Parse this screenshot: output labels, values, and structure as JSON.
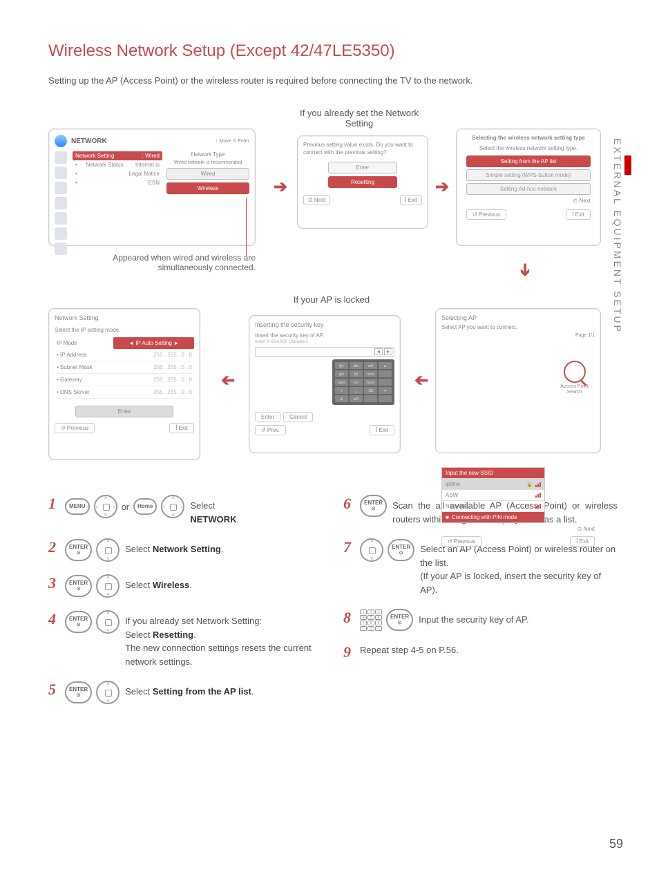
{
  "title": "Wireless Network Setup (Except 42/47LE5350)",
  "intro": "Setting up the AP (Access Point) or the wireless router is required before connecting the TV to the network.",
  "sideTab": "EXTERNAL EQUIPMENT SETUP",
  "pageNum": "59",
  "captions": {
    "a": "Appeared when wired and wireless are simultaneously connected.",
    "b": "If you already set the Network Setting",
    "c": "If your AP is locked"
  },
  "panelA": {
    "title": "NETWORK",
    "hint": "↕ Move   ⊙ Enter",
    "rows": [
      {
        "k": "Network Setting",
        "v": ": Wired",
        "sel": true
      },
      {
        "k": "Network Status",
        "v": ": Internet is"
      },
      {
        "k": "Legal Notice",
        "v": ""
      },
      {
        "k": "ESN",
        "v": ""
      }
    ],
    "rightLabel": "Network Type",
    "rightSub": "Wired network is recommended",
    "btns": [
      {
        "t": "Wired",
        "sel": false
      },
      {
        "t": "Wireless",
        "sel": true
      }
    ]
  },
  "panelB": {
    "msg": "Previous setting value exists. Do you want to connect with the previous setting?",
    "btns": [
      {
        "t": "Enter",
        "sel": false
      },
      {
        "t": "Resetting",
        "sel": true
      }
    ],
    "next": "⊙ Next",
    "exit": "ꟾ Exit"
  },
  "panelC": {
    "hdr": "Selecting the wireless network setting type",
    "sub": "Select the wireless network setting type.",
    "opts": [
      {
        "t": "Setting from the AP list",
        "sel": true
      },
      {
        "t": "Simple setting (WPS-button mode)",
        "sel": false
      },
      {
        "t": "Setting Ad-hoc network",
        "sel": false
      }
    ],
    "next": "⊙ Next",
    "prev": "↺ Previous",
    "exit": "ꟾ Exit"
  },
  "panelD": {
    "hdr": "Selecting AP",
    "sub": "Select AP you want to connect.",
    "page": "Page 1/1",
    "head": "Input the new SSID",
    "rows": [
      {
        "name": "iptime",
        "lock": true,
        "sel": true
      },
      {
        "name": "ASW",
        "lock": false,
        "sel": false
      },
      {
        "name": "Network1",
        "lock": false,
        "sel": false
      }
    ],
    "pin": "Connecting with PIN mode",
    "search": "Access Point Search",
    "next": "⊙ Next",
    "prev": "↺ Previous",
    "exit": "ꟾ Exit"
  },
  "panelE": {
    "hdr": "Inserting the security key",
    "sub": "Insert the security key of AP.",
    "hint": "Insert 8~63 ASCII characters",
    "enter": "Enter",
    "cancel": "Cancel",
    "prev": "↺ Prev.",
    "exit": "ꟾ Exit",
    "keys": [
      "@./",
      "abc",
      "def",
      "ghi",
      "jkl",
      "mno",
      "pqrs",
      "tuv",
      "wxyz",
      "⇧",
      "␣",
      "⌫",
      "⊞",
      "a/A",
      "←",
      "."
    ]
  },
  "panelF": {
    "hdr": "Network Setting",
    "sub": "Select the IP setting mode.",
    "mode": "◄ IP Auto Setting ►",
    "rows": [
      {
        "k": "IP Mode",
        "mode": true
      },
      {
        "k": "• IP Address",
        "v": "255 . 255 . 0 . 0"
      },
      {
        "k": "• Subnet Mask",
        "v": "255 . 255 . 0 . 0"
      },
      {
        "k": "• Gateway",
        "v": "255 . 255 . 0 . 0"
      },
      {
        "k": "• DNS Server",
        "v": "255 . 255 . 0 . 0"
      }
    ],
    "enter": "Enter",
    "prev": "↺ Previous",
    "exit": "ꟾ Exit"
  },
  "steps": {
    "s1": {
      "pre": "Select ",
      "bold": "NETWORK",
      "post": "."
    },
    "or": "or",
    "menu": "MENU",
    "home": "Home",
    "enter": "ENTER",
    "s2": {
      "pre": "Select ",
      "bold": "Network Setting",
      "post": "."
    },
    "s3": {
      "pre": "Select ",
      "bold": "Wireless",
      "post": "."
    },
    "s4": {
      "line1": "If you already set Network Setting:",
      "pre": "Select ",
      "bold": "Resetting",
      "post": ".",
      "line3": "The new connection settings resets the current network settings."
    },
    "s5": {
      "pre": "Select ",
      "bold": "Setting from the AP list",
      "post": "."
    },
    "s6": "Scan the all available AP (Access Point) or wireless routers within range and display them as a list.",
    "s7": {
      "line1": "Select an AP (Access Point) or wireless router on the list.",
      "line2": "(If your AP is locked, insert the security key of AP)."
    },
    "s8": "Input the security key of AP.",
    "s9": "Repeat step 4-5 on P.56."
  }
}
